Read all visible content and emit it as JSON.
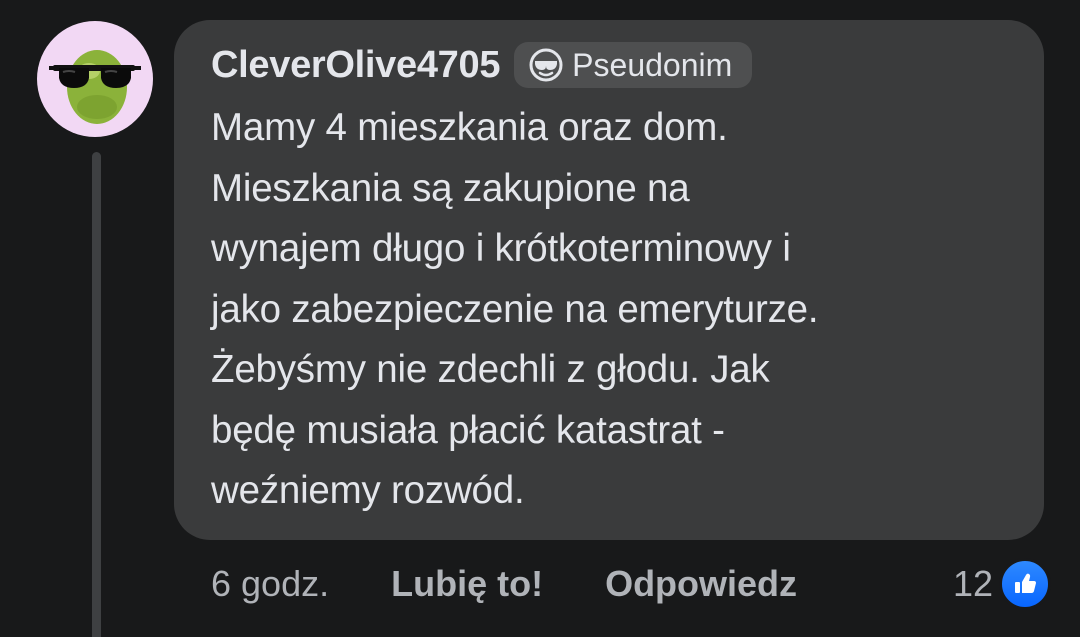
{
  "comment": {
    "author": "CleverOlive4705",
    "badge_label": "Pseudonim",
    "badge_icon": "sunglasses-icon",
    "avatar_icon": "olive-with-sunglasses-icon",
    "text": "Mamy 4 mieszkania oraz dom.\nMieszkania są zakupione na\nwynajem długo i krótkoterminowy i\njako zabezpieczenie na emeryturze.\nŻebyśmy nie zdechli z głodu. Jak\nbędę musiała płacić katastrat -\nweźniemy rozwód."
  },
  "actions": {
    "time": "6 godz.",
    "like_label": "Lubię to!",
    "reply_label": "Odpowiedz",
    "reaction_count": "12",
    "reaction_icon": "thumbs-up-icon"
  },
  "colors": {
    "background": "#18191a",
    "bubble": "#3a3b3c",
    "text_primary": "#e4e6eb",
    "text_secondary": "#b0b3b8",
    "like_blue": "#0866ff",
    "avatar_bg": "#f2d8f4"
  }
}
